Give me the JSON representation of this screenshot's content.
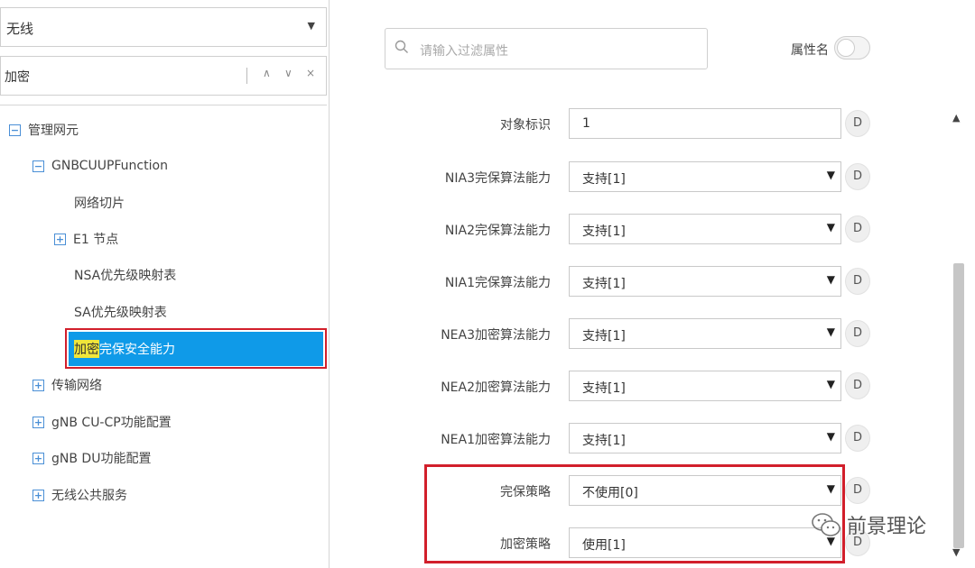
{
  "left": {
    "dropdown_value": "无线",
    "search_value": "加密",
    "nav_up": "∧",
    "nav_down": "∨",
    "nav_close": "×",
    "tree": {
      "root": "管理网元",
      "gnbcuupfunction": "GNBCUUPFunction",
      "network_slice": "网络切片",
      "e1_node": "E1 节点",
      "nsa_priority": "NSA优先级映射表",
      "sa_priority": "SA优先级映射表",
      "selected_highlight": "加密",
      "selected_rest": "完保安全能力",
      "transport": "传输网络",
      "gnb_cu_cp": "gNB CU-CP功能配置",
      "gnb_du": "gNB DU功能配置",
      "wireless_public": "无线公共服务"
    }
  },
  "right": {
    "filter_placeholder": "请输入过滤属性",
    "attr_name_label": "属性名",
    "rows": [
      {
        "label": "对象标识",
        "value": "1"
      },
      {
        "label": "NIA3完保算法能力",
        "value": "支持[1]"
      },
      {
        "label": "NIA2完保算法能力",
        "value": "支持[1]"
      },
      {
        "label": "NIA1完保算法能力",
        "value": "支持[1]"
      },
      {
        "label": "NEA3加密算法能力",
        "value": "支持[1]"
      },
      {
        "label": "NEA2加密算法能力",
        "value": "支持[1]"
      },
      {
        "label": "NEA1加密算法能力",
        "value": "支持[1]"
      },
      {
        "label": "完保策略",
        "value": "不使用[0]"
      },
      {
        "label": "加密策略",
        "value": "使用[1]"
      }
    ],
    "d_label": "D"
  },
  "watermark": "前景理论"
}
